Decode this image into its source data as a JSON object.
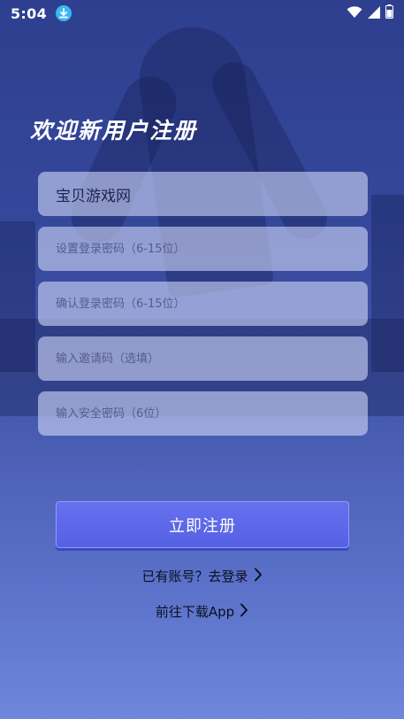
{
  "status_bar": {
    "time": "5:04",
    "icons": [
      "download-icon",
      "wifi-icon",
      "signal-icon",
      "battery-icon"
    ]
  },
  "page": {
    "title": "欢迎新用户注册"
  },
  "form": {
    "username": {
      "value": "宝贝游戏网",
      "placeholder": ""
    },
    "password": {
      "value": "",
      "placeholder": "设置登录密码（6-15位）"
    },
    "confirm_password": {
      "value": "",
      "placeholder": "确认登录密码（6-15位）"
    },
    "invite_code": {
      "value": "",
      "placeholder": "输入邀请码（选填）"
    },
    "security_password": {
      "value": "",
      "placeholder": "输入安全密码（6位）"
    },
    "submit_label": "立即注册"
  },
  "links": {
    "login": "已有账号？去登录",
    "download": "前往下载App"
  },
  "colors": {
    "button": "#5a66e8",
    "download_badge": "#39b8f3"
  }
}
